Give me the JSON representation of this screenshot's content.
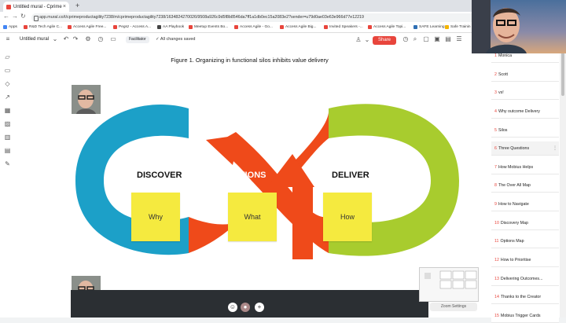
{
  "browser": {
    "tab_title": "Untitled mural - Cprime",
    "url": "app.mural.co/t/cprimeproductagility7238/m/cprimeproductagility7238/1634824270026/9508a926c9d5f8b8546da7ff1a1db0ec15a2083e2?sender=u79d0ae03e63e966d77e12219",
    "bookmarks": [
      "Apps",
      "R&D Tech Agile C...",
      "Access Agile Free...",
      "Pegsz - Access A...",
      "AA Playbook",
      "Meetup Events Bo...",
      "Access Agile - Go...",
      "Access Agile Big...",
      "Invited Speakers -...",
      "Access Agile Topi...",
      "SAFE Learning",
      "Safe Trainin"
    ]
  },
  "toolbar": {
    "mural_title": "Untitled mural",
    "facilitator_label": "Facilitator",
    "saved_status": "All changes saved",
    "share_label": "Share"
  },
  "canvas": {
    "figure_title": "Figure 1. Organizing in functional silos inhibits value delivery",
    "labels": {
      "discover": "DISCOVER",
      "options": "OPTIONS",
      "deliver": "DELIVER"
    },
    "stickies": [
      "Why",
      "What",
      "How"
    ],
    "colors": {
      "blue": "#1ca0c8",
      "red": "#ef4a1a",
      "green": "#a8cc2e",
      "sticky": "#f5ea3f"
    }
  },
  "minimap": {
    "zoom_label": "Zoom Settings"
  },
  "outline": [
    {
      "num": "1",
      "label": "Monica"
    },
    {
      "num": "2",
      "label": "Scott"
    },
    {
      "num": "3",
      "label": "vs!"
    },
    {
      "num": "4",
      "label": "Why outcome Delivery"
    },
    {
      "num": "5",
      "label": "Silos"
    },
    {
      "num": "6",
      "label": "Three Questions"
    },
    {
      "num": "7",
      "label": "How Mobius Helps"
    },
    {
      "num": "8",
      "label": "The Over All Map"
    },
    {
      "num": "9",
      "label": "How to Navigate"
    },
    {
      "num": "10",
      "label": "Discovery Map"
    },
    {
      "num": "11",
      "label": "Options Map"
    },
    {
      "num": "12",
      "label": "How to Prioritise"
    },
    {
      "num": "13",
      "label": "Delivering Outcomes..."
    },
    {
      "num": "14",
      "label": "Thanks to the Creator"
    },
    {
      "num": "15",
      "label": "Mobius Trigger Cards"
    }
  ]
}
